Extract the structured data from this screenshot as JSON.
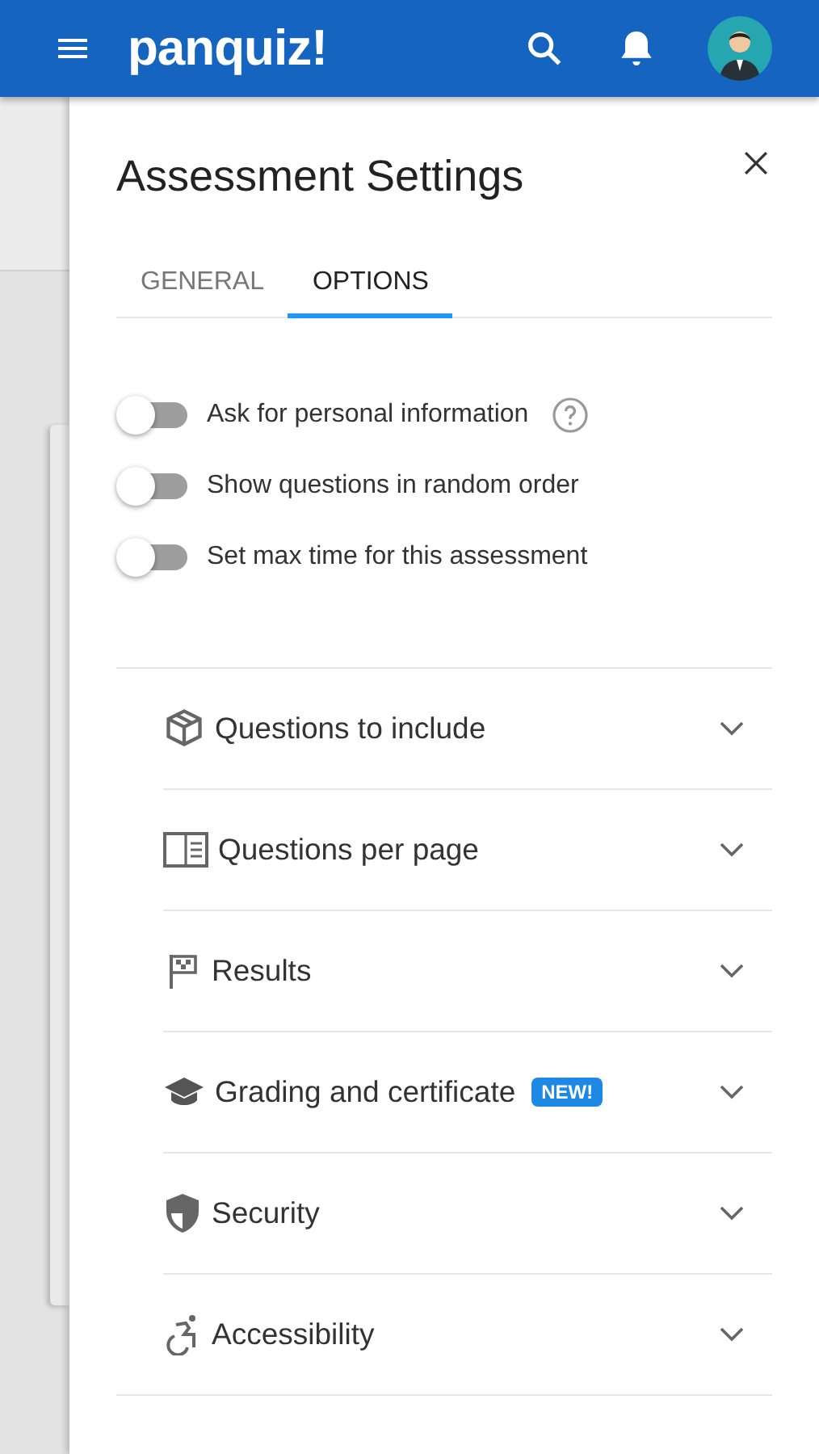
{
  "app_bar": {
    "logo": "panquiz!"
  },
  "panel": {
    "title": "Assessment Settings"
  },
  "tabs": [
    {
      "label": "GENERAL",
      "selected": false
    },
    {
      "label": "OPTIONS",
      "selected": true
    }
  ],
  "toggles": [
    {
      "label": "Ask for personal information",
      "on": false,
      "help": true
    },
    {
      "label": "Show questions in random order",
      "on": false,
      "help": false
    },
    {
      "label": "Set max time for this assessment",
      "on": false,
      "help": false
    }
  ],
  "sections": [
    {
      "kind": "box",
      "label": "Questions to include",
      "expanded": false
    },
    {
      "kind": "book",
      "label": "Questions per page",
      "expanded": false
    },
    {
      "kind": "flag",
      "label": "Results",
      "expanded": false
    },
    {
      "kind": "cap",
      "label": "Grading and certificate",
      "badge": "NEW!",
      "expanded": false
    },
    {
      "kind": "shield",
      "label": "Security",
      "expanded": false
    },
    {
      "kind": "access",
      "label": "Accessibility",
      "expanded": false
    }
  ]
}
